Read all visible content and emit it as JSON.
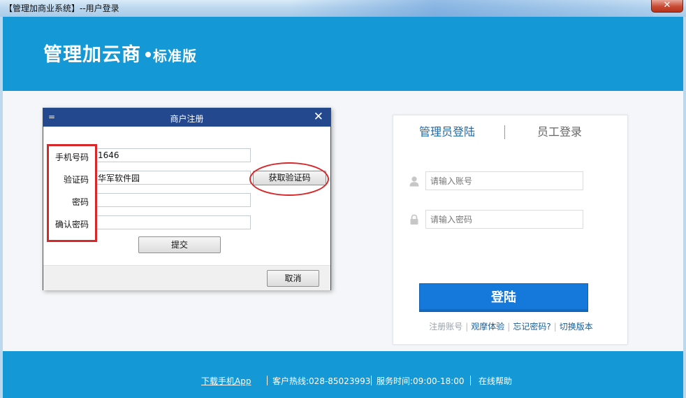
{
  "window": {
    "title": "【管理加商业系统】--用户登录",
    "close_label": "✕"
  },
  "header": {
    "brand_name": "管理加云商",
    "edition": "标准版"
  },
  "login": {
    "tabs": [
      {
        "label": "管理员登陆",
        "active": true
      },
      {
        "label": "员工登录",
        "active": false
      }
    ],
    "account_placeholder": "请输入账号",
    "password_placeholder": "请输入密码",
    "login_button": "登陆",
    "links": [
      {
        "label": "注册账号",
        "muted": true
      },
      {
        "label": "观摩体验",
        "muted": false
      },
      {
        "label": "忘记密码?",
        "muted": false
      },
      {
        "label": "切换版本",
        "muted": false
      }
    ],
    "icons": {
      "account": "user-icon",
      "password": "lock-icon"
    }
  },
  "dialog": {
    "title": "商户注册",
    "title_mark": "=",
    "close_label": "✕",
    "fields": [
      {
        "label": "手机号码",
        "value": "1646"
      },
      {
        "label": "验证码",
        "value": "华军软件园"
      },
      {
        "label": "密码",
        "value": ""
      },
      {
        "label": "确认密码",
        "value": ""
      }
    ],
    "get_code_button": "获取验证码",
    "submit_button": "提交",
    "cancel_button": "取消"
  },
  "footer": {
    "download_app": "下载手机App",
    "hotline": "客户热线:028-85023993",
    "service_hours": "服务时间:09:00-18:00",
    "online_help": "在线帮助"
  },
  "colors": {
    "brand_blue": "#1499d6",
    "dialog_title": "#24488d",
    "login_button": "#1579db",
    "annotation_red": "#d8272a"
  }
}
